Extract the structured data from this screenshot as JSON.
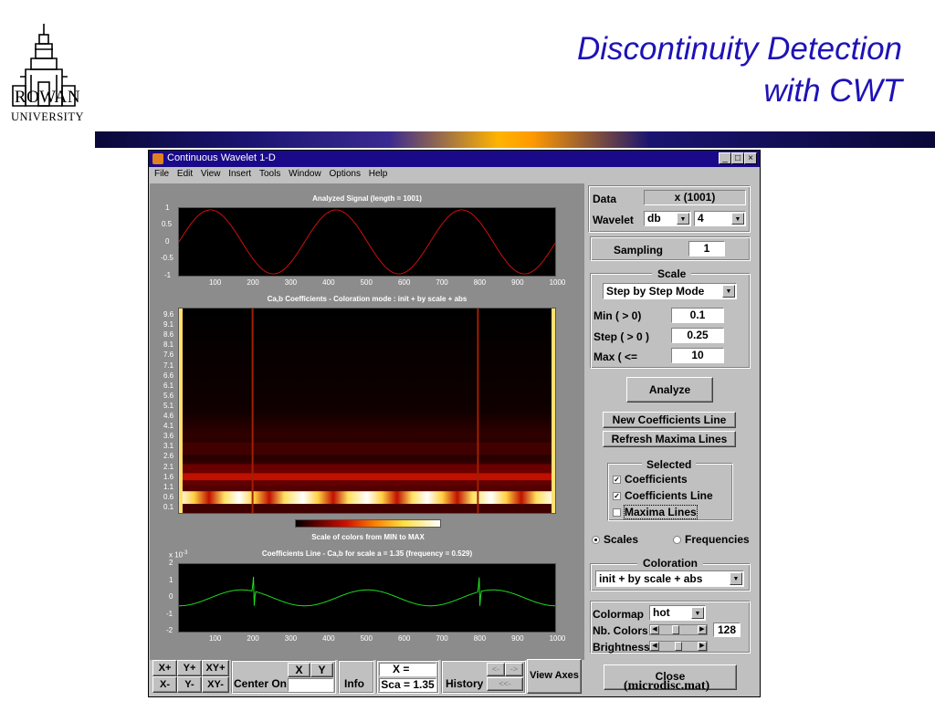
{
  "slide": {
    "title_line1": "Discontinuity Detection",
    "title_line2": "with CWT",
    "logo_line1": "ROWAN",
    "logo_line2": "UNIVERSITY",
    "caption": "(microdisc.mat)"
  },
  "window": {
    "title": "Continuous Wavelet 1-D",
    "controls": [
      "_",
      "□",
      "×"
    ],
    "menu": [
      "File",
      "Edit",
      "View",
      "Insert",
      "Tools",
      "Window",
      "Options",
      "Help"
    ]
  },
  "plots": {
    "signal": {
      "title": "Analyzed Signal  (length = 1001)",
      "yticks": [
        "1",
        "0.5",
        "0",
        "-0.5",
        "-1"
      ],
      "xticks": [
        "100",
        "200",
        "300",
        "400",
        "500",
        "600",
        "700",
        "800",
        "900",
        "1000"
      ]
    },
    "coeffs": {
      "title": "Ca,b Coefficients  - Coloration mode : init + by scale + abs",
      "yticks": [
        "9.6",
        "9.1",
        "8.6",
        "8.1",
        "7.6",
        "7.1",
        "6.6",
        "6.1",
        "5.6",
        "5.1",
        "4.6",
        "4.1",
        "3.6",
        "3.1",
        "2.6",
        "2.1",
        "1.6",
        "1.1",
        "0.6",
        "0.1"
      ]
    },
    "colorbar": {
      "label": "Scale of colors from MIN to MAX"
    },
    "line": {
      "title": "Coefficients Line - Ca,b   for scale a = 1.35  (frequency =   0.529)",
      "exponent": "x 10",
      "exponent_power": "-3",
      "yticks": [
        "2",
        "1",
        "0",
        "-1",
        "-2"
      ],
      "xticks": [
        "100",
        "200",
        "300",
        "400",
        "500",
        "600",
        "700",
        "800",
        "900",
        "1000"
      ]
    }
  },
  "chart_data": [
    {
      "type": "line",
      "title": "Analyzed Signal  (length = 1001)",
      "xlim": [
        1,
        1001
      ],
      "ylim": [
        -1,
        1
      ],
      "series": [
        {
          "color": "#d01010",
          "amplitude": 1,
          "period": 334,
          "phase_deg": 0,
          "x": [
            1,
            84,
            168,
            251,
            335,
            418,
            502,
            585,
            669,
            752,
            836,
            919,
            1001
          ],
          "y": [
            0,
            1,
            0,
            -1,
            0,
            1,
            0,
            -1,
            0,
            1,
            0,
            -1,
            0
          ]
        }
      ]
    },
    {
      "type": "line",
      "title": "Coefficients Line - Ca,b   for scale a = 1.35  (frequency =   0.529)",
      "xlim": [
        1,
        1001
      ],
      "ylim": [
        -2,
        2
      ],
      "y_multiplier": "x 10^-3",
      "series": [
        {
          "color": "#20e020",
          "x": [
            1,
            84,
            168,
            200,
            251,
            335,
            418,
            502,
            585,
            669,
            752,
            800,
            836,
            919,
            1001
          ],
          "y": [
            -0.5,
            0,
            0.5,
            0.5,
            0,
            -0.5,
            0,
            0.5,
            0,
            -0.5,
            0,
            0.5,
            0.5,
            0,
            -0.5
          ],
          "spikes_at_x": [
            200,
            800
          ]
        }
      ]
    }
  ],
  "panel": {
    "data_label": "Data",
    "data_value": "x  (1001)",
    "wavelet_label": "Wavelet",
    "wavelet_family": "db",
    "wavelet_order": "4",
    "sampling_label": "Sampling",
    "sampling_value": "1",
    "scale_title": "Scale",
    "scale_mode": "Step by Step Mode",
    "min_label": "Min  ( > 0)",
    "min_value": "0.1",
    "step_label": "Step ( > 0 )",
    "step_value": "0.25",
    "max_label": "Max  ( <=",
    "max_value": "10",
    "analyze": "Analyze",
    "new_coef_line": "New Coefficients Line",
    "refresh_maxima": "Refresh Maxima Lines",
    "selected_title": "Selected",
    "sel_coefficients": "Coefficients",
    "sel_coef_line": "Coefficients Line",
    "sel_maxima": "Maxima Lines",
    "scales": "Scales",
    "frequencies": "Frequencies",
    "coloration_title": "Coloration",
    "coloration_value": "init + by scale + abs",
    "colormap_label": "Colormap",
    "colormap_value": "hot",
    "nb_colors_label": "Nb. Colors",
    "nb_colors_value": "128",
    "brightness_label": "Brightness",
    "close": "Close"
  },
  "toolbar": {
    "xplus": "X+",
    "yplus": "Y+",
    "xyplus": "XY+",
    "xminus": "X-",
    "yminus": "Y-",
    "xyminus": "XY-",
    "x": "X",
    "y": "Y",
    "center_on": "Center On",
    "info": "Info",
    "x_eq": "X =",
    "sca": "Sca = 1.35",
    "history": "History",
    "hist_prev": "<-",
    "hist_next": "->",
    "hist_first": "<<-",
    "view_axes": "View Axes"
  }
}
